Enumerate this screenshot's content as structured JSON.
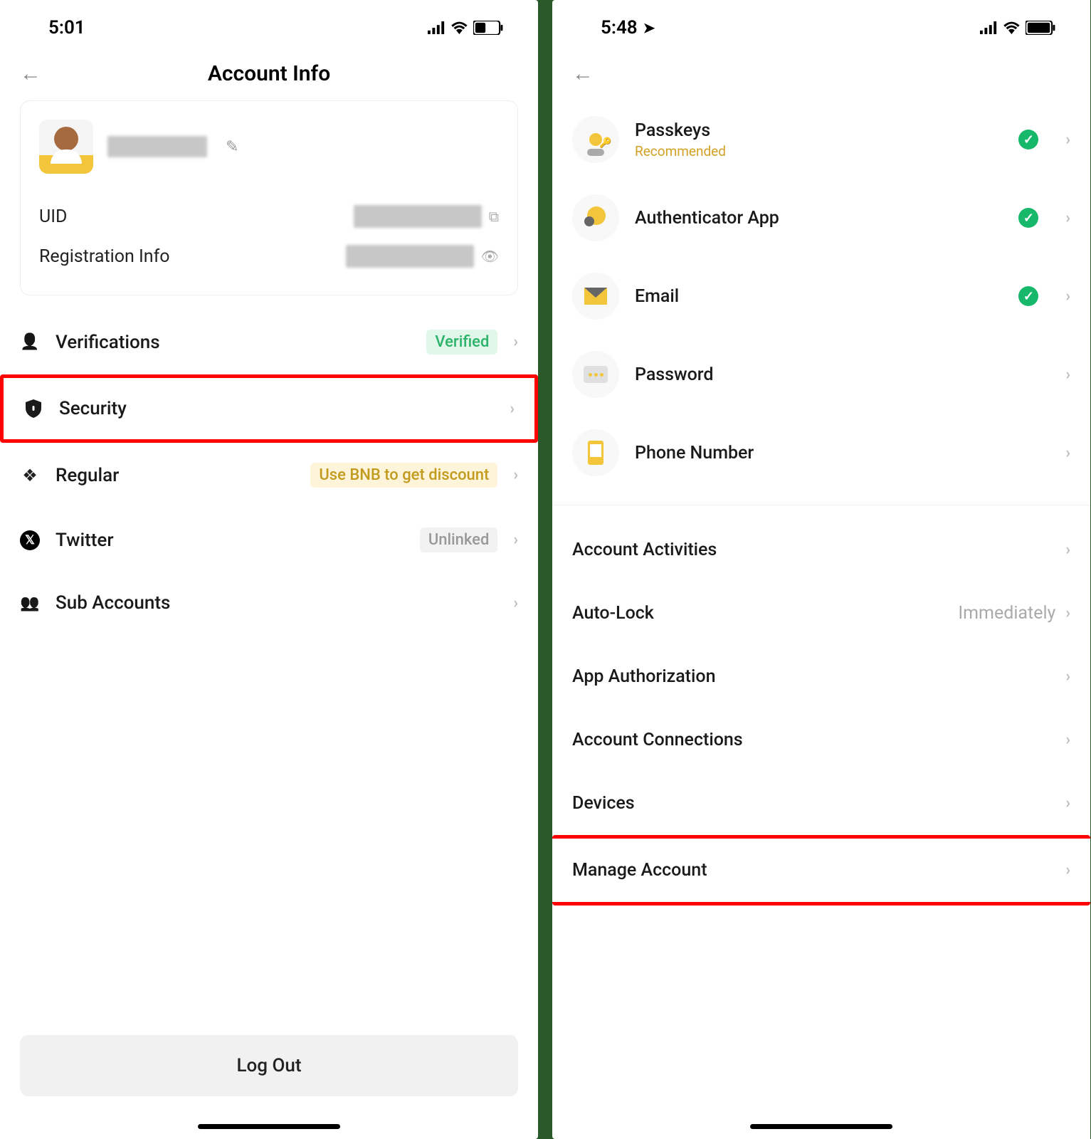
{
  "left": {
    "status": {
      "time": "5:01"
    },
    "title": "Account Info",
    "card": {
      "uid_label": "UID",
      "reg_label": "Registration Info"
    },
    "items": {
      "verifications": {
        "label": "Verifications",
        "badge": "Verified"
      },
      "security": {
        "label": "Security"
      },
      "regular": {
        "label": "Regular",
        "badge": "Use BNB to get discount"
      },
      "twitter": {
        "label": "Twitter",
        "badge": "Unlinked"
      },
      "subaccounts": {
        "label": "Sub Accounts"
      }
    },
    "logout": "Log Out"
  },
  "right": {
    "status": {
      "time": "5:48"
    },
    "sec_items": {
      "passkeys": {
        "label": "Passkeys",
        "sub": "Recommended",
        "checked": true
      },
      "authenticator": {
        "label": "Authenticator App",
        "checked": true
      },
      "email": {
        "label": "Email",
        "checked": true
      },
      "password": {
        "label": "Password",
        "checked": false
      },
      "phone": {
        "label": "Phone Number",
        "checked": false
      }
    },
    "simple_items": {
      "activities": {
        "label": "Account Activities"
      },
      "autolock": {
        "label": "Auto-Lock",
        "value": "Immediately"
      },
      "appauth": {
        "label": "App Authorization"
      },
      "connections": {
        "label": "Account Connections"
      },
      "devices": {
        "label": "Devices"
      },
      "manage": {
        "label": "Manage Account"
      }
    }
  }
}
